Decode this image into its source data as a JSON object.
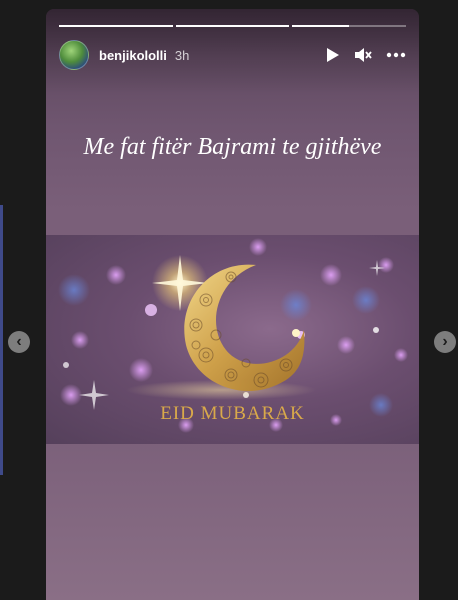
{
  "story": {
    "username": "benjikololli",
    "time": "3h",
    "progress": [
      1,
      1,
      0.5
    ],
    "caption": "Me fat fitër Bajrami te gjithëve",
    "image": {
      "greeting": "EID MUBARAK",
      "accent_color": "#d9a94a"
    }
  },
  "icons": {
    "play": "play-icon",
    "mute": "muted-speaker-icon",
    "more": "more-options-icon",
    "prev": "chevron-left-icon",
    "next": "chevron-right-icon"
  }
}
